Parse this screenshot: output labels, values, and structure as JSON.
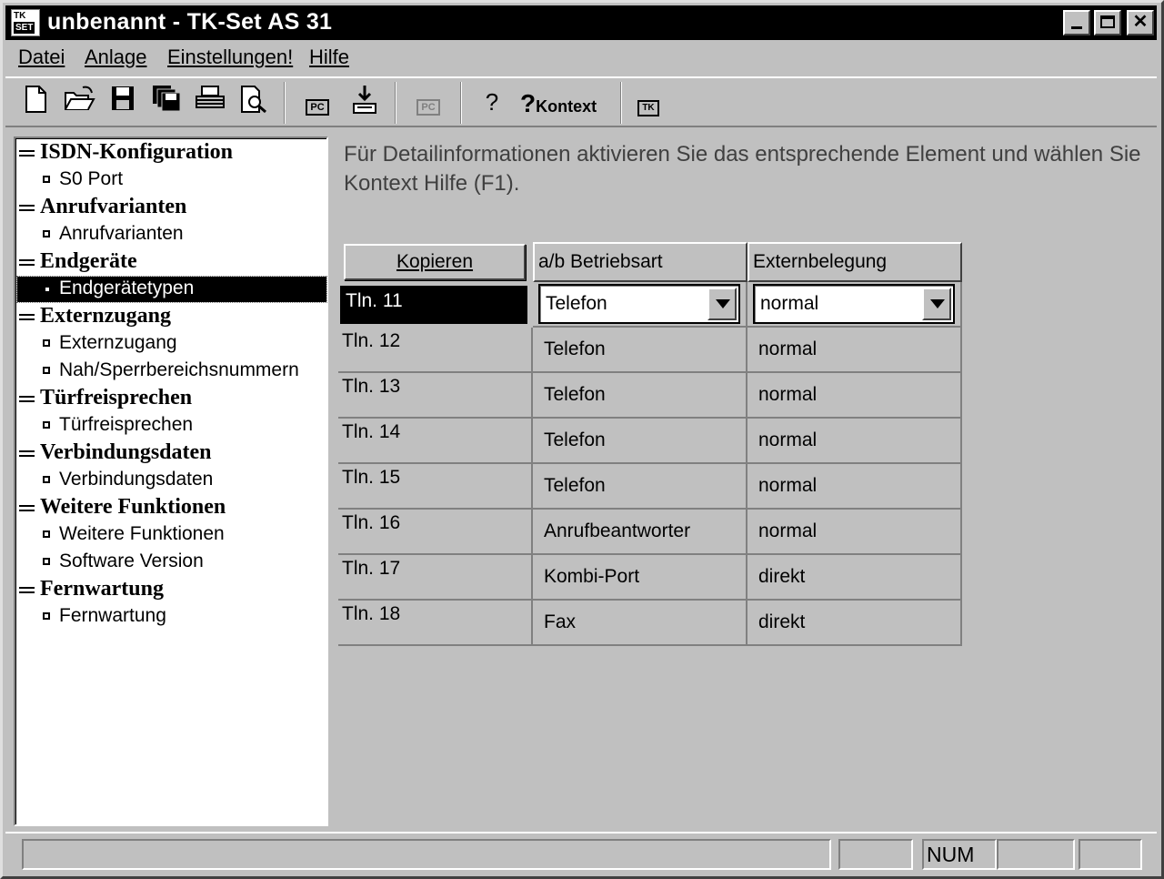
{
  "window": {
    "title": "unbenannt - TK-Set AS 31",
    "icon_text": [
      "TK",
      "SET"
    ]
  },
  "menu": {
    "items": [
      {
        "label": "Datei"
      },
      {
        "label": "Anlage"
      },
      {
        "label": "Einstellungen!"
      },
      {
        "label": "Hilfe"
      }
    ]
  },
  "toolbar": {
    "kontext_label": "Kontext",
    "pc_label": "PC",
    "tk_label": "TK"
  },
  "tree": {
    "categories": [
      {
        "label": "ISDN-Konfiguration",
        "items": [
          "S0 Port"
        ]
      },
      {
        "label": "Anrufvarianten",
        "items": [
          "Anrufvarianten"
        ]
      },
      {
        "label": "Endgeräte",
        "items": [
          "Endgerätetypen"
        ]
      },
      {
        "label": "Externzugang",
        "items": [
          "Externzugang",
          "Nah/Sperrbereichsnummern"
        ]
      },
      {
        "label": "Türfreisprechen",
        "items": [
          "Türfreisprechen"
        ]
      },
      {
        "label": "Verbindungsdaten",
        "items": [
          "Verbindungsdaten"
        ]
      },
      {
        "label": "Weitere Funktionen",
        "items": [
          "Weitere Funktionen",
          "Software Version"
        ]
      },
      {
        "label": "Fernwartung",
        "items": [
          "Fernwartung"
        ]
      }
    ],
    "selected": "Endgerätetypen"
  },
  "main": {
    "info_text": "Für Detailinformationen aktivieren Sie das entsprechende Element und wählen Sie Kontext Hilfe (F1).",
    "copy_button": "Kopieren",
    "columns": [
      "a/b Betriebsart",
      "Externbelegung"
    ],
    "rows": [
      {
        "name": "Tln. 11",
        "betriebsart": "Telefon",
        "externbelegung": "normal"
      },
      {
        "name": "Tln. 12",
        "betriebsart": "Telefon",
        "externbelegung": "normal"
      },
      {
        "name": "Tln. 13",
        "betriebsart": "Telefon",
        "externbelegung": "normal"
      },
      {
        "name": "Tln. 14",
        "betriebsart": "Telefon",
        "externbelegung": "normal"
      },
      {
        "name": "Tln. 15",
        "betriebsart": "Telefon",
        "externbelegung": "normal"
      },
      {
        "name": "Tln. 16",
        "betriebsart": "Anrufbeantworter",
        "externbelegung": "normal"
      },
      {
        "name": "Tln. 17",
        "betriebsart": "Kombi-Port",
        "externbelegung": "direkt"
      },
      {
        "name": "Tln. 18",
        "betriebsart": "Fax",
        "externbelegung": "direkt"
      }
    ]
  },
  "statusbar": {
    "num_indicator": "NUM"
  }
}
